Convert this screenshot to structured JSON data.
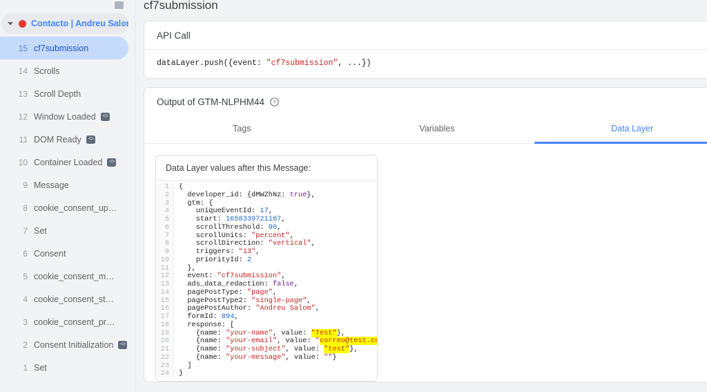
{
  "sidebar": {
    "cut_row_label": "",
    "container": {
      "label": "Contacto | Andreu Salom",
      "status_dot": "#e03a2f",
      "caret": "chevron-down-icon"
    },
    "messages": [
      {
        "index": "15",
        "name": "cf7submission",
        "badge": "",
        "selected": true
      },
      {
        "index": "14",
        "name": "Scrolls",
        "badge": "",
        "selected": false
      },
      {
        "index": "13",
        "name": "Scroll Depth",
        "badge": "",
        "selected": false
      },
      {
        "index": "12",
        "name": "Window Loaded",
        "badge": "<>",
        "selected": false
      },
      {
        "index": "11",
        "name": "DOM Ready",
        "badge": "<>",
        "selected": false
      },
      {
        "index": "10",
        "name": "Container Loaded",
        "badge": "<>",
        "selected": false
      },
      {
        "index": "9",
        "name": "Message",
        "badge": "",
        "selected": false
      },
      {
        "index": "8",
        "name": "cookie_consent_update",
        "badge": "",
        "selected": false
      },
      {
        "index": "7",
        "name": "Set",
        "badge": "",
        "selected": false
      },
      {
        "index": "6",
        "name": "Consent",
        "badge": "",
        "selected": false
      },
      {
        "index": "5",
        "name": "cookie_consent_marketi…",
        "badge": "",
        "selected": false
      },
      {
        "index": "4",
        "name": "cookie_consent_statistics",
        "badge": "",
        "selected": false
      },
      {
        "index": "3",
        "name": "cookie_consent_prefere…",
        "badge": "",
        "selected": false
      },
      {
        "index": "2",
        "name": "Consent Initialization",
        "badge": "<>",
        "selected": false
      },
      {
        "index": "1",
        "name": "Set",
        "badge": "",
        "selected": false
      }
    ]
  },
  "main": {
    "page_title": "cf7submission",
    "api_card": {
      "title": "API Call",
      "code_prefix": "dataLayer.push({event: ",
      "code_string": "\"cf7submission\"",
      "code_suffix": ", ...})"
    },
    "output_card": {
      "title": "Output of GTM-NLPHM44",
      "help_icon": "help-circle-icon",
      "tabs": [
        {
          "label": "Tags",
          "active": false
        },
        {
          "label": "Variables",
          "active": false
        },
        {
          "label": "Data Layer",
          "active": true
        }
      ],
      "datalayer_panel": {
        "title": "Data Layer values after this Message:",
        "line_numbers": [
          "1",
          "2",
          "3",
          "4",
          "5",
          "6",
          "7",
          "8",
          "9",
          "10",
          "11",
          "12",
          "13",
          "14",
          "15",
          "16",
          "17",
          "18",
          "19",
          "20",
          "21",
          "22",
          "23",
          "24"
        ],
        "code_lines": [
          "{",
          "  developer_id: {dMWZhNz: §k§true§/§},",
          "  gtm: {",
          "    uniqueEventId: §n§17§/§,",
          "    start: §n§1658339721187§/§,",
          "    scrollThreshold: §n§90§/§,",
          "    scrollUnits: §s§\"percent\"§/§,",
          "    scrollDirection: §s§\"vertical\"§/§,",
          "    triggers: §s§\"13\"§/§,",
          "    priorityId: §n§2§/§",
          "  },",
          "  event: §s§\"cf7submission\"§/§,",
          "  ads_data_redaction: §k§false§/§,",
          "  pagePostType: §s§\"page\"§/§,",
          "  pagePostType2: §s§\"single-page\"§/§,",
          "  pagePostAuthor: §s§\"Andreu Salom\"§/§,",
          "  formId: §n§894§/§,",
          "  response: [",
          "    {name: §s§\"your-name\"§/§, value: §h§§s§\"Test\"§/§§/h§},",
          "    {name: §s§\"your-email\"§/§, value: §s§\"§/§§h§§s§correo@test.com§/§§/h§§s§\"§/§},",
          "    {name: §s§\"your-subject\"§/§, value: §h§§s§\"test\"§/§§/h§},",
          "    {name: §s§\"your-message\"§/§, value: §s§\"\"§/§}",
          "  ]",
          "}"
        ]
      }
    }
  },
  "colors": {
    "accent_blue": "#4285f4",
    "selected_row": "#c6dafc",
    "string_red": "#c5221f",
    "number_blue": "#1967d2",
    "keyword_purple": "#7b1fa2",
    "highlight_yellow": "#ffff00",
    "status_red": "#e03a2f",
    "page_bg": "#f1f3f4"
  }
}
